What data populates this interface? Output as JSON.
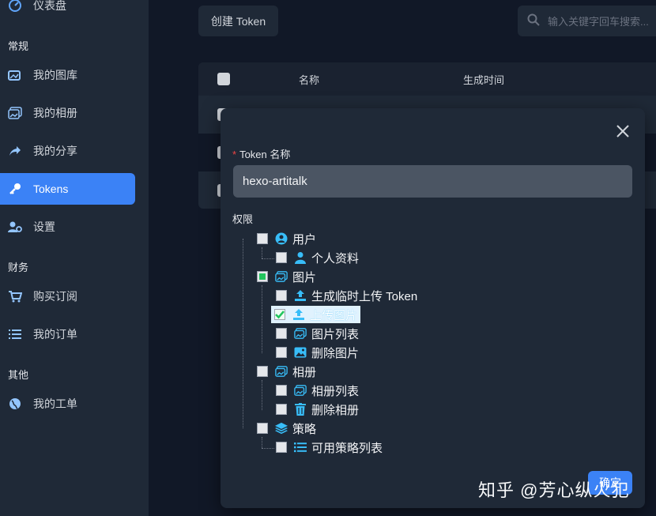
{
  "sidebar": {
    "top_item": "仪表盘",
    "sections": {
      "regular": "常规",
      "finance": "财务",
      "other": "其他"
    },
    "items": [
      {
        "label": "我的图库",
        "icon": "images-icon"
      },
      {
        "label": "我的相册",
        "icon": "album-icon"
      },
      {
        "label": "我的分享",
        "icon": "share-icon"
      },
      {
        "label": "Tokens",
        "icon": "key-icon",
        "active": true
      },
      {
        "label": "设置",
        "icon": "user-settings-icon"
      },
      {
        "label": "购买订阅",
        "icon": "cart-icon"
      },
      {
        "label": "我的订单",
        "icon": "list-icon"
      },
      {
        "label": "我的工单",
        "icon": "globe-icon"
      }
    ]
  },
  "toolbar": {
    "create_label": "创建 Token",
    "search_placeholder": "输入关键字回车搜索..."
  },
  "table": {
    "headers": [
      "名称",
      "生成时间"
    ]
  },
  "modal": {
    "name_label": "Token 名称",
    "required_mark": "*",
    "name_value": "hexo-artitalk",
    "perm_label": "权限",
    "tree": {
      "user": "用户",
      "profile": "个人资料",
      "images": "图片",
      "gen_temp_token": "生成临时上传 Token",
      "upload_image": "上传图片",
      "image_list": "图片列表",
      "delete_image": "删除图片",
      "album": "相册",
      "album_list": "相册列表",
      "delete_album": "删除相册",
      "strategy": "策略",
      "strategy_list": "可用策略列表"
    },
    "confirm_label": "确定"
  },
  "watermark": "知乎 @芳心纵火犯",
  "colors": {
    "accent": "#3b82f6",
    "icon_blue": "#38bdf8",
    "check_green": "#22c55e"
  }
}
